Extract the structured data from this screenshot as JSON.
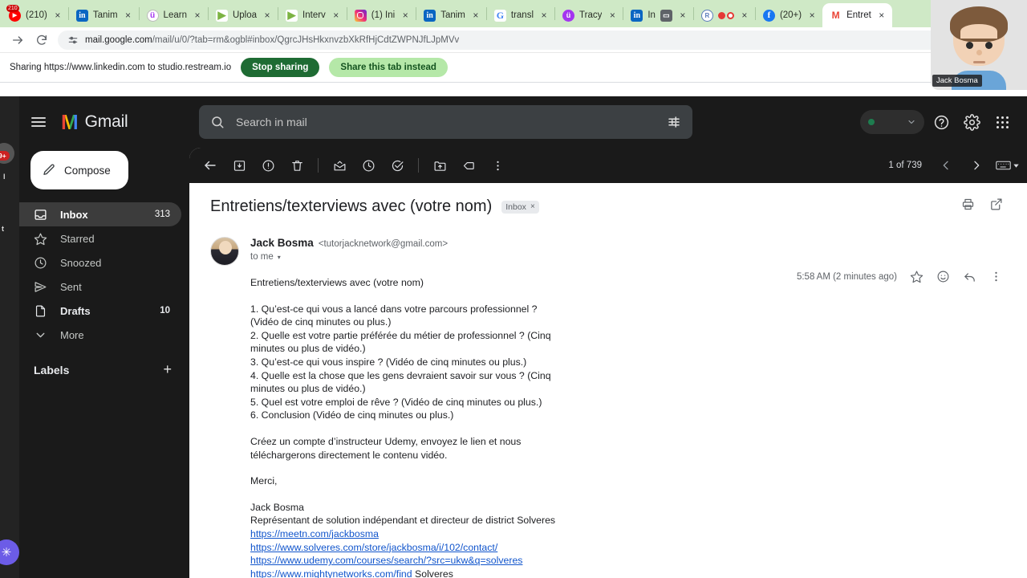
{
  "browser": {
    "tabs": [
      {
        "title": "(210)",
        "favicon": "youtube-icon",
        "badge": "210"
      },
      {
        "title": "Tanim",
        "favicon": "linkedin-icon"
      },
      {
        "title": "Learn",
        "favicon": "udemy-icon"
      },
      {
        "title": "Uploa",
        "favicon": "play-icon"
      },
      {
        "title": "Interv",
        "favicon": "play-icon"
      },
      {
        "title": "(1) Ini",
        "favicon": "instagram-icon"
      },
      {
        "title": "Tanim",
        "favicon": "linkedin-icon"
      },
      {
        "title": "transl",
        "favicon": "google-icon"
      },
      {
        "title": "Tracy",
        "favicon": "tracy-icon"
      },
      {
        "title": "In",
        "favicon": "linkedin-icon"
      },
      {
        "title": "",
        "favicon": "restream-icon"
      },
      {
        "title": "(20+)",
        "favicon": "facebook-icon"
      },
      {
        "title": "Entret",
        "favicon": "gmail-icon",
        "active": true
      }
    ],
    "close_label": "×",
    "address": {
      "url_host": "mail.google.com",
      "url_path": "/mail/u/0/?tab=rm&ogbl#inbox/QgrcJHsHkxnvzbXkRfHjCdtZWPNJfLJpMVv",
      "forward_icon": "forward-arrow-icon",
      "reload_icon": "reload-icon",
      "site_info_icon": "site-settings-icon",
      "bookmark_icon": "star-icon"
    },
    "share_bar": {
      "message": "Sharing https://www.linkedin.com to studio.restream.io",
      "stop_label": "Stop sharing",
      "share_label": "Share this tab instead",
      "stop_color": "#1e6b33",
      "share_color": "#b5e8a8"
    }
  },
  "webcam": {
    "name": "Jack Bosma"
  },
  "gmail": {
    "logo_mark": "M",
    "logo_word": "Gmail",
    "search": {
      "placeholder": "Search in mail",
      "search_icon": "search-icon",
      "filter_icon": "tune-icon"
    },
    "header_icons": {
      "help": "help-icon",
      "settings": "gear-icon",
      "apps": "apps-grid-icon",
      "status_caret": "chevron-down-icon"
    },
    "compose": {
      "label": "Compose",
      "icon": "pencil-icon"
    },
    "sidebar": {
      "items": [
        {
          "label": "Inbox",
          "icon": "inbox-icon",
          "count": "313",
          "active": true
        },
        {
          "label": "Starred",
          "icon": "star-icon",
          "count": ""
        },
        {
          "label": "Snoozed",
          "icon": "clock-icon",
          "count": ""
        },
        {
          "label": "Sent",
          "icon": "send-icon",
          "count": ""
        },
        {
          "label": "Drafts",
          "icon": "draft-icon",
          "count": "10",
          "bold": true
        },
        {
          "label": "More",
          "icon": "chevron-down-icon",
          "count": ""
        }
      ],
      "labels_title": "Labels",
      "labels_add": "+"
    },
    "toolbar": {
      "back_icon": "back-arrow-icon",
      "archive_icon": "archive-icon",
      "report_spam_icon": "report-spam-icon",
      "delete_icon": "trash-icon",
      "mark_unread_icon": "mark-unread-icon",
      "snooze_icon": "clock-icon",
      "add_task_icon": "add-task-icon",
      "move_to_icon": "move-to-folder-icon",
      "label_icon": "label-tag-icon",
      "more_icon": "more-vertical-icon",
      "count": "1 of 739",
      "prev_icon": "chevron-left-icon",
      "next_icon": "chevron-right-icon",
      "keyboard_icon": "keyboard-icon",
      "keyboard_caret": "chevron-down-icon"
    },
    "message": {
      "subject": "Entretiens/texterviews avec (votre nom)",
      "label_chip": "Inbox",
      "chip_close": "×",
      "print_icon": "print-icon",
      "open_new_window_icon": "open-in-new-icon",
      "sender_name": "Jack Bosma",
      "sender_email": "<tutorjacknetwork@gmail.com>",
      "recipient": "to me",
      "recipient_caret": "▾",
      "timestamp": "5:58 AM (2 minutes ago)",
      "star_icon": "star-icon",
      "emoji_icon": "add-reaction-icon",
      "reply_icon": "reply-icon",
      "more_icon": "more-vertical-icon",
      "body": {
        "intro": "Entretiens/texterviews avec (votre nom)",
        "questions": [
          "1. Qu’est-ce qui vous a lancé dans votre parcours professionnel ?",
          "(Vidéo de cinq minutes ou plus.)",
          "2. Quelle est votre partie préférée du métier de professionnel ? (Cinq minutes ou plus de vidéo.)",
          "3. Qu’est-ce qui vous inspire ? (Vidéo de cinq minutes ou plus.)",
          "4. Quelle est la chose que les gens devraient savoir sur vous ? (Cinq minutes ou plus de vidéo.)",
          "5. Quel est votre emploi de rêve ? (Vidéo de cinq minutes ou plus.)",
          "6. Conclusion (Vidéo de cinq minutes ou plus.)"
        ],
        "udemy_note": "Créez un compte d’instructeur Udemy, envoyez le lien et nous téléchargerons directement le contenu vidéo.",
        "thanks": "Merci,",
        "sig_name": "Jack Bosma",
        "sig_title": "Représentant de solution indépendant et directeur de district Solveres",
        "links": [
          "https://meetn.com/jackbosma",
          "https://www.solveres.com/store/jackbosma/i/102/contact/",
          "https://www.udemy.com/courses/search/?src=ukw&q=solveres",
          "https://www.mightynetworks.com/find"
        ],
        "link_suffix": " Solveres"
      }
    }
  },
  "behind_app": {
    "badge": "9+",
    "button_icon": "sparkle-icon"
  }
}
